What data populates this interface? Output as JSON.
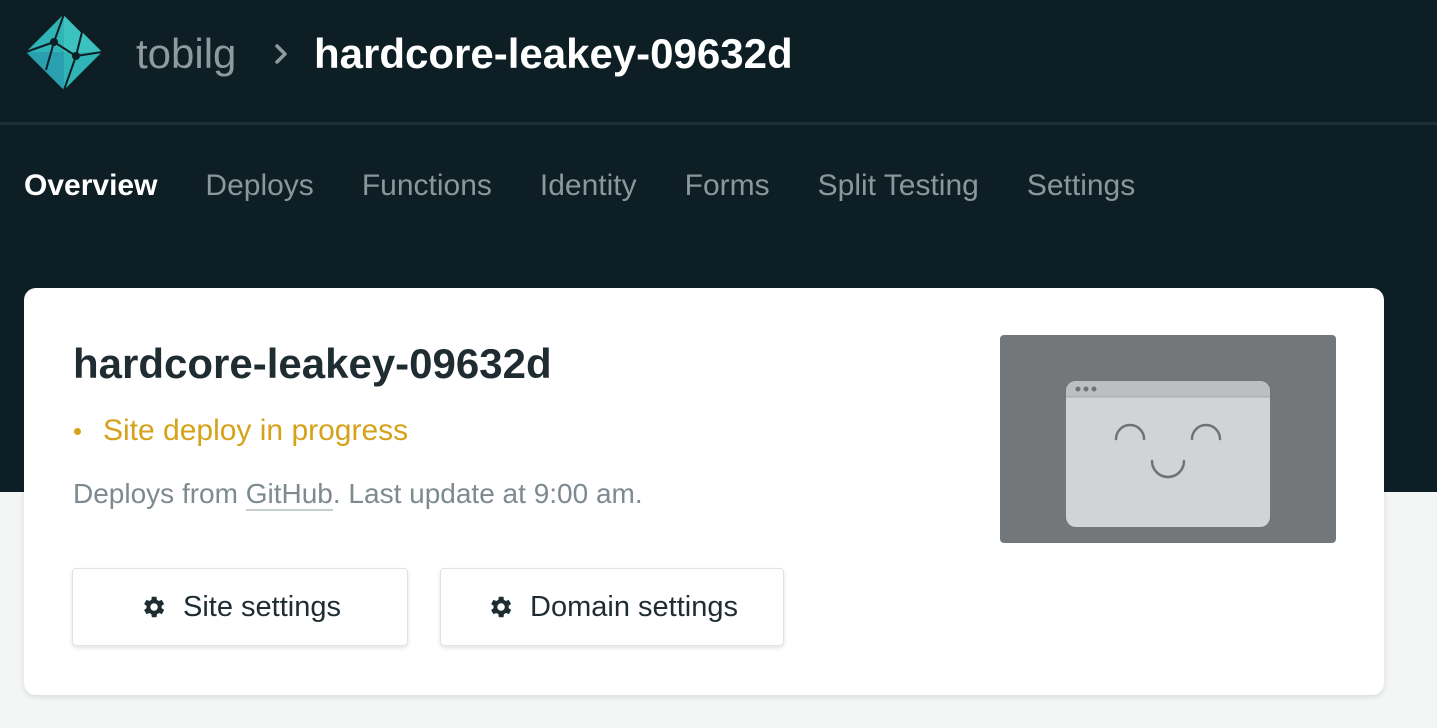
{
  "header": {
    "team_name": "tobilg",
    "separator_icon": "chevron-right-icon",
    "site_name": "hardcore-leakey-09632d",
    "logo_icon": "netlify-logo-icon"
  },
  "tabs": [
    {
      "label": "Overview",
      "active": true
    },
    {
      "label": "Deploys",
      "active": false
    },
    {
      "label": "Functions",
      "active": false
    },
    {
      "label": "Identity",
      "active": false
    },
    {
      "label": "Forms",
      "active": false
    },
    {
      "label": "Split Testing",
      "active": false
    },
    {
      "label": "Settings",
      "active": false
    }
  ],
  "card": {
    "site_name": "hardcore-leakey-09632d",
    "status": "Site deploy in progress",
    "deploy_prefix": "Deploys from ",
    "deploy_source": "GitHub",
    "deploy_suffix": ". Last update at 9:00 am.",
    "site_settings_label": "Site settings",
    "domain_settings_label": "Domain settings",
    "button_icon": "gear-icon",
    "preview_icon": "smiling-browser-icon"
  },
  "colors": {
    "header_bg": "#0e1e25",
    "accent_logo": "#2fb5b5",
    "status_warning": "#d6a21b",
    "page_bg": "#f4f6f6"
  }
}
